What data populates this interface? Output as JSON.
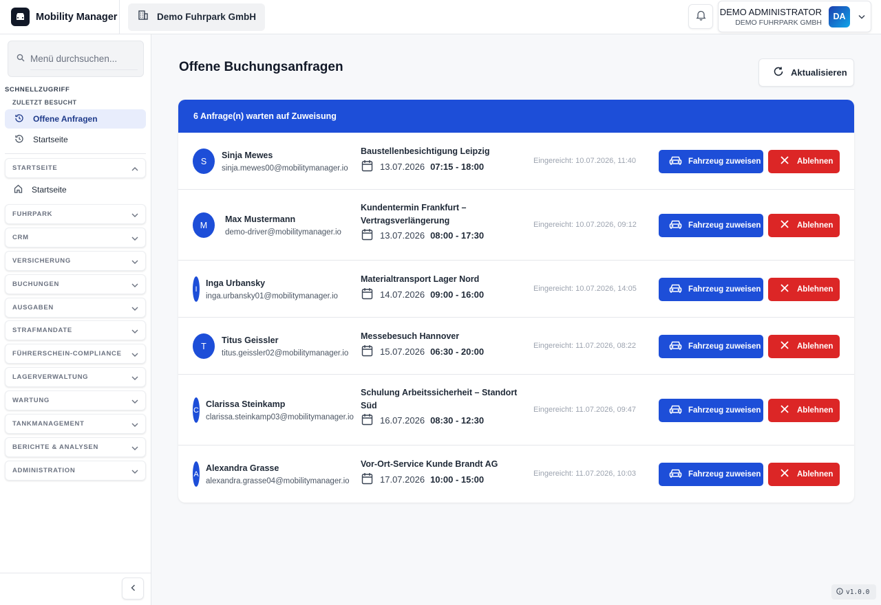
{
  "app": {
    "name": "Mobility Manager",
    "company": "Demo Fuhrpark GmbH"
  },
  "user": {
    "name": "DEMO ADMINISTRATOR",
    "company": "DEMO FUHRPARK GMBH",
    "initials": "DA"
  },
  "sidebar": {
    "search_placeholder": "Menü durchsuchen...",
    "quick_access": "SCHNELLZUGRIFF",
    "recently_visited": "ZULETZT BESUCHT",
    "recent_items": [
      "Offene Anfragen",
      "Startseite"
    ],
    "groups": {
      "startseite": "STARTSEITE",
      "startseite_item": "Startseite",
      "fuhrpark": "FUHRPARK",
      "crm": "CRM",
      "versicherung": "VERSICHERUNG",
      "buchungen": "BUCHUNGEN",
      "ausgaben": "AUSGABEN",
      "strafmandate": "STRAFMANDATE",
      "fuehrerschein": "FÜHRERSCHEIN-COMPLIANCE",
      "lager": "LAGERVERWALTUNG",
      "wartung": "WARTUNG",
      "tank": "TANKMANAGEMENT",
      "berichte": "BERICHTE & ANALYSEN",
      "admin": "ADMINISTRATION"
    }
  },
  "main": {
    "title": "Offene Buchungsanfragen",
    "refresh_label": "Aktualisieren",
    "banner": "6 Anfrage(n) warten auf Zuweisung",
    "assign_label": "Fahrzeug zuweisen",
    "reject_label": "Ablehnen",
    "requests": [
      {
        "initial": "S",
        "name": "Sinja Mewes",
        "email": "sinja.mewes00@mobilitymanager.io",
        "purpose": "Baustellenbesichtigung Leipzig",
        "date": "13.07.2026",
        "time": "07:15 - 18:00",
        "submitted": "Eingereicht: 10.07.2026, 11:40"
      },
      {
        "initial": "M",
        "name": "Max Mustermann",
        "email": "demo-driver@mobilitymanager.io",
        "purpose": "Kundentermin Frankfurt – Vertragsverlängerung",
        "date": "13.07.2026",
        "time": "08:00 - 17:30",
        "submitted": "Eingereicht: 10.07.2026, 09:12"
      },
      {
        "initial": "I",
        "name": "Inga Urbansky",
        "email": "inga.urbansky01@mobilitymanager.io",
        "purpose": "Materialtransport Lager Nord",
        "date": "14.07.2026",
        "time": "09:00 - 16:00",
        "submitted": "Eingereicht: 10.07.2026, 14:05"
      },
      {
        "initial": "T",
        "name": "Titus Geissler",
        "email": "titus.geissler02@mobilitymanager.io",
        "purpose": "Messebesuch Hannover",
        "date": "15.07.2026",
        "time": "06:30 - 20:00",
        "submitted": "Eingereicht: 11.07.2026, 08:22"
      },
      {
        "initial": "C",
        "name": "Clarissa Steinkamp",
        "email": "clarissa.steinkamp03@mobilitymanager.io",
        "purpose": "Schulung Arbeitssicherheit – Standort Süd",
        "date": "16.07.2026",
        "time": "08:30 - 12:30",
        "submitted": "Eingereicht: 11.07.2026, 09:47"
      },
      {
        "initial": "A",
        "name": "Alexandra Grasse",
        "email": "alexandra.grasse04@mobilitymanager.io",
        "purpose": "Vor-Ort-Service Kunde Brandt AG",
        "date": "17.07.2026",
        "time": "10:00 - 15:00",
        "submitted": "Eingereicht: 11.07.2026, 10:03"
      }
    ]
  },
  "version": "v1.0.0",
  "colors": {
    "primary": "#1d4ed8",
    "danger": "#dc2626",
    "accent_bg": "#e8edfc"
  }
}
